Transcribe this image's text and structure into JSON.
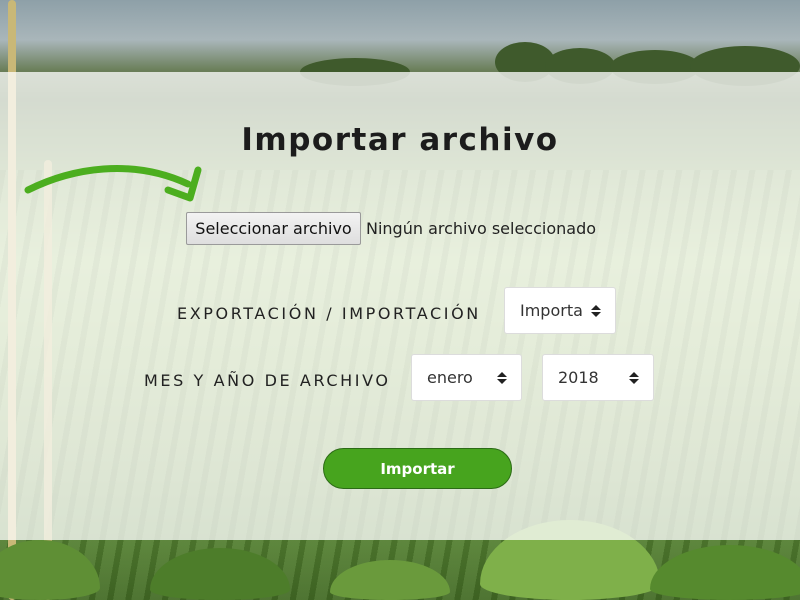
{
  "page": {
    "title": "Importar archivo"
  },
  "file_picker": {
    "button_label": "Seleccionar archivo",
    "status_text": "Ningún archivo seleccionado"
  },
  "export_import": {
    "label": "EXPORTACIÓN / IMPORTACIÓN",
    "selected": "Importa"
  },
  "month_year": {
    "label": "MES Y AÑO DE ARCHIVO",
    "month_selected": "enero",
    "year_selected": "2018"
  },
  "actions": {
    "import_label": "Importar"
  },
  "colors": {
    "accent_green": "#47a41e",
    "arrow_green": "#4cae1f",
    "panel": "rgba(255,255,255,0.76)"
  },
  "icons": {
    "arrow": "curved-arrow-icon",
    "select_arrows": "up-down-caret-icon"
  }
}
